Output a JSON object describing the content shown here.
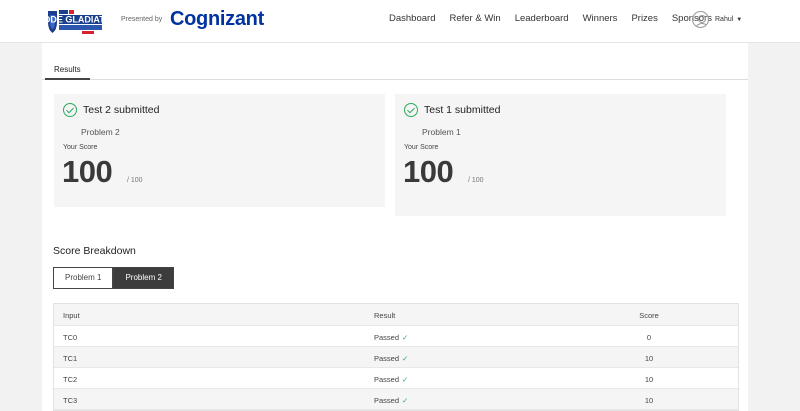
{
  "header": {
    "logo_text": "CODE GLADIATORS",
    "presented_by": "Presented by",
    "brand": "Cognizant",
    "nav": [
      "Dashboard",
      "Refer & Win",
      "Leaderboard",
      "Winners",
      "Prizes",
      "Sponsors"
    ],
    "user_name": "Rahul",
    "caret": "▼"
  },
  "tabs": {
    "results": "Results"
  },
  "cards": [
    {
      "title": "Test 2 submitted",
      "problem": "Problem 2",
      "label": "Your Score",
      "score": "100",
      "max": "/ 100"
    },
    {
      "title": "Test 1 submitted",
      "problem": "Problem 1",
      "label": "Your Score",
      "score": "100",
      "max": "/ 100"
    }
  ],
  "breakdown": {
    "title": "Score Breakdown",
    "buttons": [
      "Problem 1",
      "Problem 2"
    ],
    "active": "Problem 2",
    "columns": [
      "Input",
      "Result",
      "Score"
    ],
    "rows": [
      {
        "input": "TC0",
        "result": "Passed",
        "score": "0"
      },
      {
        "input": "TC1",
        "result": "Passed",
        "score": "10"
      },
      {
        "input": "TC2",
        "result": "Passed",
        "score": "10"
      },
      {
        "input": "TC3",
        "result": "Passed",
        "score": "10"
      }
    ],
    "tick": "✓"
  },
  "colors": {
    "brand": "#0033a1",
    "success": "#2eaa5f",
    "active_button": "#3c3c3c"
  }
}
